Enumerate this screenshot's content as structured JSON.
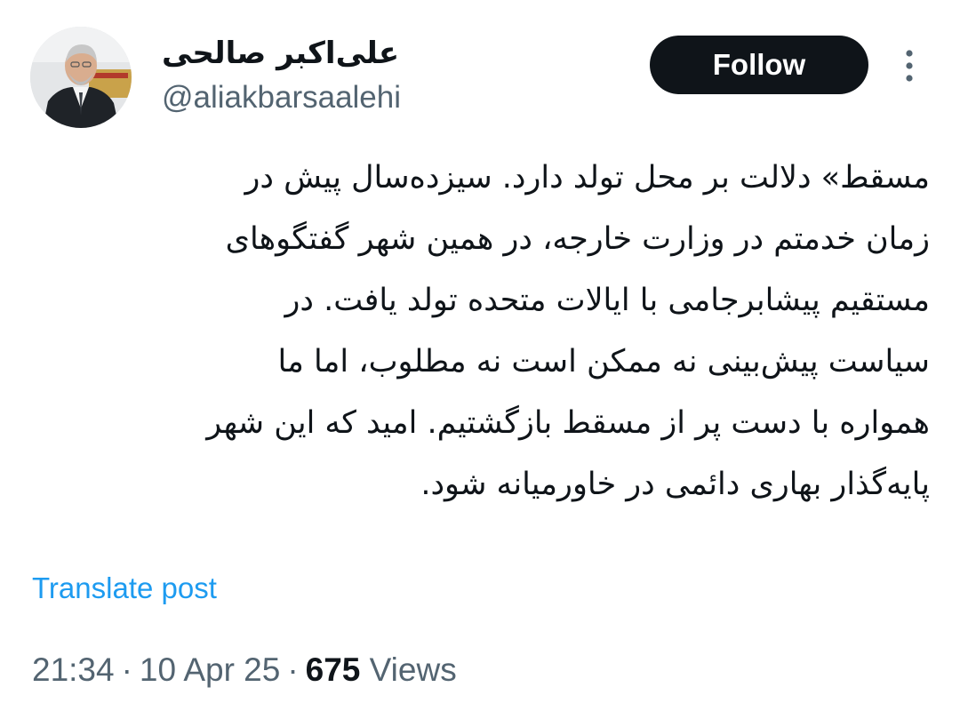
{
  "author": {
    "display_name": "علی‌اکبر صالحی",
    "handle": "@aliakbarsaalehi"
  },
  "actions": {
    "follow_label": "Follow",
    "more_icon": "more-vertical-icon"
  },
  "tweet": {
    "lines": [
      "مسقط» دلالت بر محل تولد دارد. سیزده‌سال پیش در",
      "زمان خدمتم در وزارت خارجه، در همین شهر گفتگوهای",
      "مستقیم  پیشابرجامی با ایالات متحده تولد یافت. در",
      "سیاست پیش‌بینی  نه ممکن است نه مطلوب، اما ما",
      "همواره با دست پر از مسقط بازگشتیم. امید که این شهر",
      "پایه‌گذار بهاری دائمی در خاورمیانه شود."
    ],
    "translate_label": "Translate post"
  },
  "meta": {
    "time": "21:34",
    "separator": "·",
    "date": "10 Apr 25",
    "views_count": "675",
    "views_label": "Views"
  },
  "colors": {
    "text_primary": "#0f1419",
    "text_secondary": "#536471",
    "link": "#1d9bf0",
    "follow_bg": "#0f1419"
  }
}
